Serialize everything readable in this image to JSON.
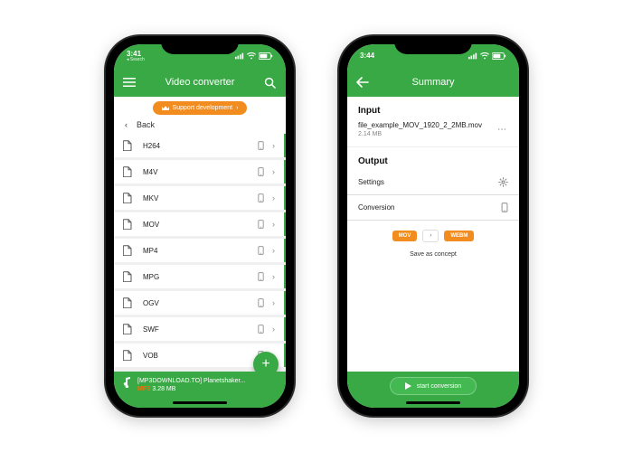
{
  "phone1": {
    "status": {
      "time": "3:41",
      "search_label": "Search"
    },
    "appbar": {
      "title": "Video converter"
    },
    "support_btn": "Support development",
    "back_label": "Back",
    "formats": [
      "H264",
      "M4V",
      "MKV",
      "MOV",
      "MP4",
      "MPG",
      "OGV",
      "SWF",
      "VOB"
    ],
    "bottom": {
      "filename": "[MP3DOWNLOAD.TO] Planetshaker...",
      "format": "MP3",
      "size": "3.28 MB"
    }
  },
  "phone2": {
    "status": {
      "time": "3:44"
    },
    "appbar": {
      "title": "Summary"
    },
    "input_section": "Input",
    "file": {
      "name": "file_example_MOV_1920_2_2MB.mov",
      "size": "2.14 MB"
    },
    "output_section": "Output",
    "rows": {
      "settings": "Settings",
      "conversion": "Conversion"
    },
    "chip_from": "MOV",
    "chip_to": "WEBM",
    "save_concept": "Save as concept",
    "start_conversion": "start conversion"
  }
}
